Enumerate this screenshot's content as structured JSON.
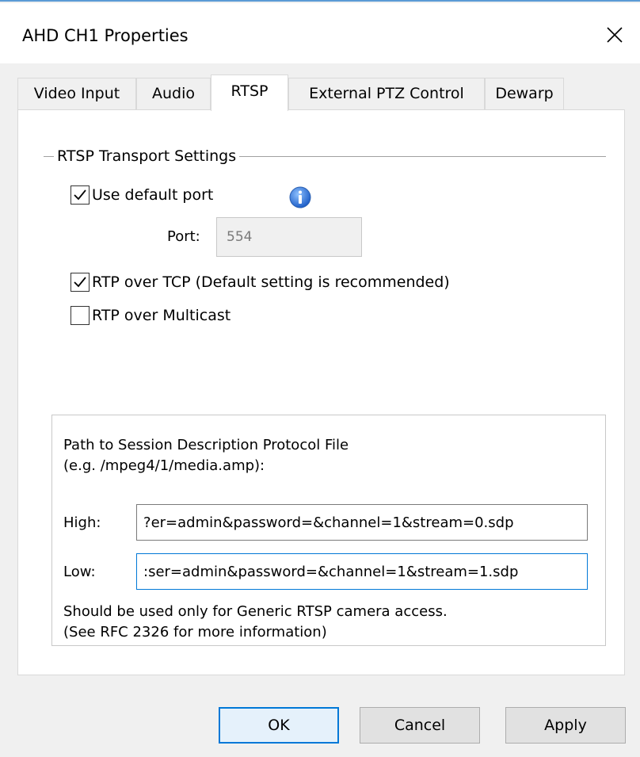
{
  "window": {
    "title": "AHD CH1 Properties"
  },
  "tabs": [
    {
      "label": "Video Input",
      "active": false
    },
    {
      "label": "Audio",
      "active": false
    },
    {
      "label": "RTSP",
      "active": true
    },
    {
      "label": "External PTZ Control",
      "active": false
    },
    {
      "label": "Dewarp",
      "active": false
    }
  ],
  "rtsp": {
    "group_label": "RTSP Transport Settings",
    "use_default_port": {
      "label": "Use default port",
      "checked": true
    },
    "port": {
      "label": "Port:",
      "value": "554"
    },
    "rtp_over_tcp": {
      "label": "RTP over TCP (Default setting is recommended)",
      "checked": true
    },
    "rtp_over_multicast": {
      "label": "RTP over Multicast",
      "checked": false
    }
  },
  "sdp": {
    "heading_line1": "Path to Session Description Protocol File",
    "heading_line2": "(e.g. /mpeg4/1/media.amp):",
    "high": {
      "label": "High:",
      "value": "er=admin&password=&channel=1&stream=0.sdp?"
    },
    "low": {
      "label": "Low:",
      "value": "ser=admin&password=&channel=1&stream=1.sdp:"
    },
    "note_line1": "Should be used only for Generic RTSP camera access.",
    "note_line2": "(See RFC 2326 for more information)"
  },
  "buttons": {
    "ok": "OK",
    "cancel": "Cancel",
    "apply": "Apply"
  },
  "colors": {
    "accent": "#0078d7",
    "info_icon": "#1f6fd0"
  },
  "icons": {
    "close": "close-icon",
    "info": "info-icon",
    "check": "checkmark-icon"
  }
}
